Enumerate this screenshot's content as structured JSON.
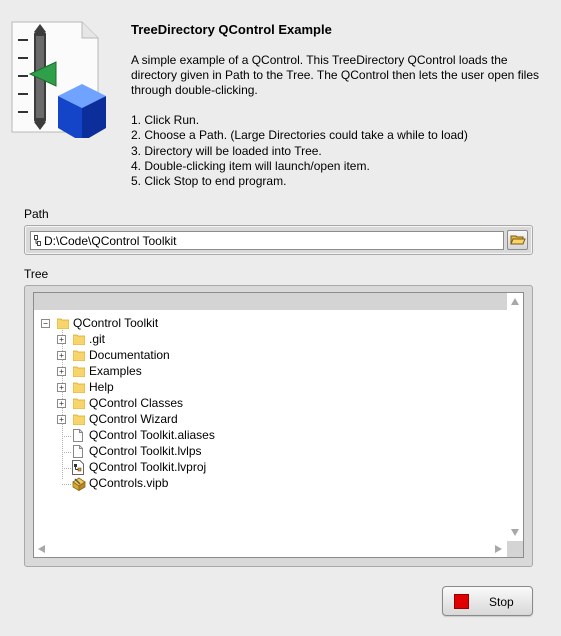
{
  "header": {
    "title": "TreeDirectory QControl Example",
    "description": "A simple example of a QControl.  This TreeDirectory QControl loads the directory given in Path to the Tree.  The QControl then lets the user open files through double-clicking.",
    "steps": [
      "1. Click Run.",
      "2. Choose a Path.  (Large Directories could take a while to load)",
      "3. Directory will be loaded into Tree.",
      "4. Double-clicking item will launch/open item.",
      "5. Click Stop to end program."
    ],
    "icon": "qcontrol-slider-cube-icon"
  },
  "path": {
    "label": "Path",
    "value": "D:\\Code\\QControl Toolkit",
    "browse_icon": "open-folder-icon"
  },
  "tree": {
    "label": "Tree",
    "root": {
      "label": "QControl Toolkit",
      "expanded": true,
      "icon": "folder-icon"
    },
    "items": [
      {
        "label": ".git",
        "type": "folder",
        "icon": "folder-icon",
        "expandable": true
      },
      {
        "label": "Documentation",
        "type": "folder",
        "icon": "folder-icon",
        "expandable": true
      },
      {
        "label": "Examples",
        "type": "folder",
        "icon": "folder-icon",
        "expandable": true
      },
      {
        "label": "Help",
        "type": "folder",
        "icon": "folder-icon",
        "expandable": true
      },
      {
        "label": "QControl Classes",
        "type": "folder",
        "icon": "folder-icon",
        "expandable": true
      },
      {
        "label": "QControl Wizard",
        "type": "folder",
        "icon": "folder-icon",
        "expandable": true
      },
      {
        "label": "QControl Toolkit.aliases",
        "type": "file",
        "icon": "file-icon",
        "expandable": false
      },
      {
        "label": "QControl Toolkit.lvlps",
        "type": "file",
        "icon": "file-icon",
        "expandable": false
      },
      {
        "label": "QControl Toolkit.lvproj",
        "type": "file",
        "icon": "lvproj-icon",
        "expandable": false
      },
      {
        "label": "QControls.vipb",
        "type": "file",
        "icon": "vipb-icon",
        "expandable": false
      }
    ]
  },
  "stop": {
    "label": "Stop",
    "color": "#e00000"
  },
  "colors": {
    "folder": "#f7d56a",
    "panel": "#ececec",
    "tree_header": "#d4d4d4"
  }
}
